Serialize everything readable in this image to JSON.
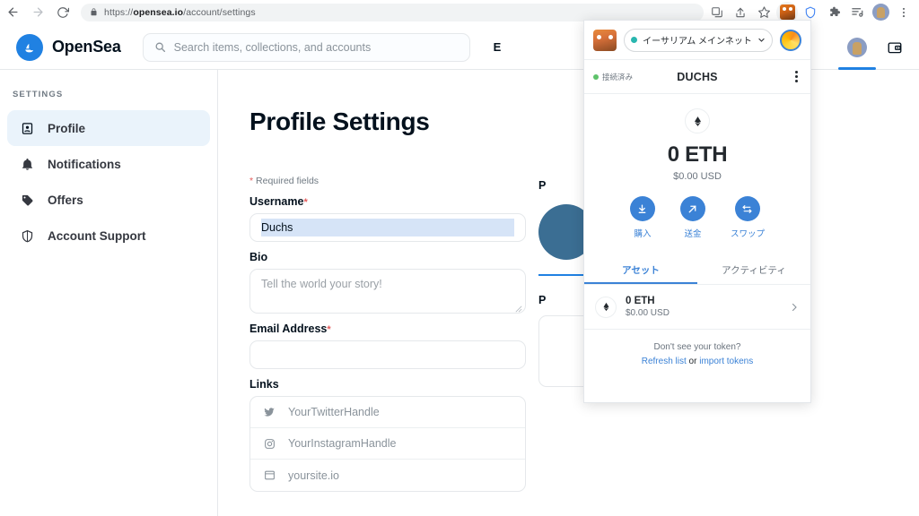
{
  "browser": {
    "back_icon": "back-arrow-icon",
    "forward_icon": "forward-arrow-icon",
    "reload_icon": "reload-icon",
    "lock_icon": "lock-icon",
    "url_scheme": "https://",
    "url_domain": "opensea.io",
    "url_path": "/account/settings",
    "toolbar_icons": [
      "translate-icon",
      "share-icon",
      "bookmark-star-icon",
      "metamask-extension-icon",
      "shield-extension-icon",
      "extensions-puzzle-icon",
      "reading-list-icon",
      "browser-profile-avatar",
      "browser-menu-icon"
    ]
  },
  "site_header": {
    "logo_text": "OpenSea",
    "logo_icon": "opensea-logo-icon",
    "search_placeholder": "Search items, collections, and accounts",
    "search_icon": "search-icon",
    "nav_items": [
      "E"
    ],
    "account_avatar": "account-avatar",
    "wallet_icon": "wallet-icon"
  },
  "sidebar": {
    "section_title": "SETTINGS",
    "items": [
      {
        "label": "Profile",
        "icon": "user-icon",
        "active": true
      },
      {
        "label": "Notifications",
        "icon": "bell-icon",
        "active": false
      },
      {
        "label": "Offers",
        "icon": "tag-icon",
        "active": false
      },
      {
        "label": "Account Support",
        "icon": "shield-icon",
        "active": false
      }
    ]
  },
  "main": {
    "page_title": "Profile Settings",
    "required_note": "Required fields",
    "required_star": "*",
    "username": {
      "label": "Username",
      "required": "*",
      "value": "Duchs"
    },
    "bio": {
      "label": "Bio",
      "placeholder": "Tell the world your story!",
      "value": ""
    },
    "email": {
      "label": "Email Address",
      "required": "*",
      "value": "",
      "placeholder": ""
    },
    "links": {
      "label": "Links",
      "rows": [
        {
          "icon": "twitter-icon",
          "placeholder": "YourTwitterHandle"
        },
        {
          "icon": "instagram-icon",
          "placeholder": "YourInstagramHandle"
        },
        {
          "icon": "website-icon",
          "placeholder": "yoursite.io"
        }
      ]
    },
    "right_column": {
      "profile_image_label": "P",
      "profile_banner_label": "P"
    }
  },
  "metamask": {
    "network": "イーサリアム メインネット",
    "network_chevron": "chevron-down-icon",
    "fox_icon": "metamask-fox-icon",
    "account_avatar": "metamask-account-avatar",
    "connected_status": "接続済み",
    "account_name": "DUCHS",
    "menu_icon": "kebab-menu-icon",
    "token_icon": "ethereum-icon",
    "balance": "0 ETH",
    "fiat_balance": "$0.00 USD",
    "actions": [
      {
        "label": "購入",
        "icon": "buy-download-icon"
      },
      {
        "label": "送金",
        "icon": "send-arrow-icon"
      },
      {
        "label": "スワップ",
        "icon": "swap-icon"
      }
    ],
    "tabs": [
      {
        "label": "アセット",
        "active": true
      },
      {
        "label": "アクティビティ",
        "active": false
      }
    ],
    "assets": [
      {
        "icon": "ethereum-icon",
        "amount": "0 ETH",
        "fiat": "$0.00 USD",
        "arrow": "chevron-right-icon"
      }
    ],
    "footer": {
      "question": "Don't see your token?",
      "refresh_link": "Refresh list",
      "or_text": "or",
      "import_link": "import tokens"
    }
  }
}
